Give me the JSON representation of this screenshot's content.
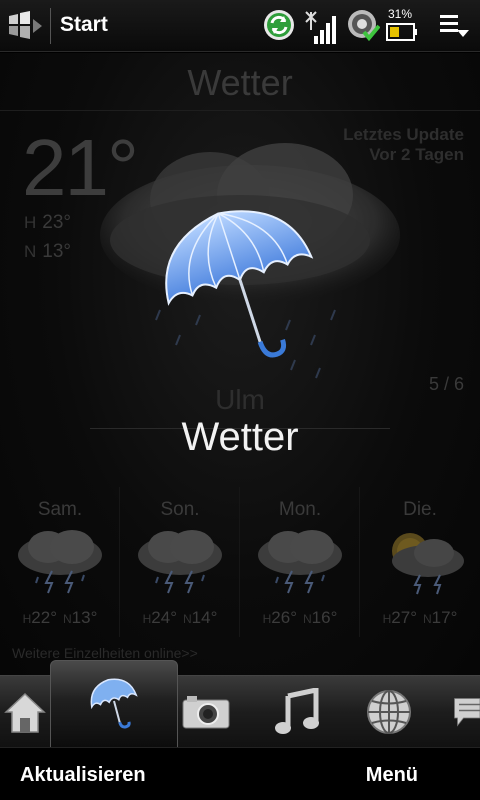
{
  "statusbar": {
    "start_label": "Start",
    "battery_percent": "31%",
    "icons": [
      "windows-start-icon",
      "sync-icon",
      "signal-icon",
      "sound-icon",
      "battery-icon",
      "menu-icon"
    ]
  },
  "weather": {
    "title": "Wetter",
    "temperature": "21°",
    "high_label": "H",
    "high_value": "23°",
    "low_label": "N",
    "low_value": "13°",
    "update_label": "Letztes Update",
    "update_value": "Vor 2 Tagen",
    "condition_icon": "umbrella-rain-icon",
    "page_indicator": "5 / 6",
    "city": "Ulm",
    "widget_name": "Wetter"
  },
  "forecast": [
    {
      "day": "Sam.",
      "icon": "thunderstorm-icon",
      "high_label": "H",
      "high": "22°",
      "low_label": "N",
      "low": "13°"
    },
    {
      "day": "Son.",
      "icon": "thunderstorm-icon",
      "high_label": "H",
      "high": "24°",
      "low_label": "N",
      "low": "14°"
    },
    {
      "day": "Mon.",
      "icon": "thunderstorm-icon",
      "high_label": "H",
      "high": "26°",
      "low_label": "N",
      "low": "16°"
    },
    {
      "day": "Die.",
      "icon": "sun-cloud-storm-icon",
      "high_label": "H",
      "high": "27°",
      "low_label": "N",
      "low": "17°"
    }
  ],
  "details_link": "Weitere Einzelheiten online>>",
  "tabs": [
    {
      "name": "home",
      "icon": "home-icon"
    },
    {
      "name": "weather",
      "icon": "umbrella-icon",
      "active": true
    },
    {
      "name": "photos",
      "icon": "camera-icon"
    },
    {
      "name": "music",
      "icon": "music-note-icon"
    },
    {
      "name": "internet",
      "icon": "globe-icon"
    },
    {
      "name": "messages",
      "icon": "message-icon"
    }
  ],
  "softkeys": {
    "left": "Aktualisieren",
    "right": "Menü"
  },
  "colors": {
    "background": "#000000",
    "umbrella": "#6fa7f0",
    "dim_text": "#3a3a3a",
    "highlight_text": "#f2f2f2"
  }
}
